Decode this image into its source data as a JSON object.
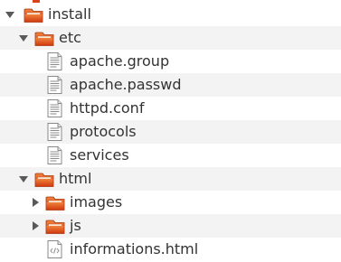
{
  "tree": {
    "install": {
      "label": "install",
      "icon": "folder-icon",
      "state": "expanded"
    },
    "etc": {
      "label": "etc",
      "icon": "folder-icon",
      "state": "expanded"
    },
    "files_etc": [
      {
        "label": "apache.group",
        "icon": "text-file-icon"
      },
      {
        "label": "apache.passwd",
        "icon": "text-file-icon"
      },
      {
        "label": "httpd.conf",
        "icon": "text-file-icon"
      },
      {
        "label": "protocols",
        "icon": "text-file-icon"
      },
      {
        "label": "services",
        "icon": "text-file-icon"
      }
    ],
    "html": {
      "label": "html",
      "icon": "folder-icon",
      "state": "expanded"
    },
    "html_children": [
      {
        "label": "images",
        "icon": "folder-icon",
        "state": "collapsed"
      },
      {
        "label": "js",
        "icon": "folder-icon",
        "state": "collapsed"
      }
    ],
    "html_file": {
      "label": "informations.html",
      "icon": "html-file-icon"
    }
  },
  "colors": {
    "folder_orange": "#e8581f",
    "folder_light": "#f4c9a3",
    "row_alt": "#f3f3f3",
    "arrow": "#595959"
  }
}
